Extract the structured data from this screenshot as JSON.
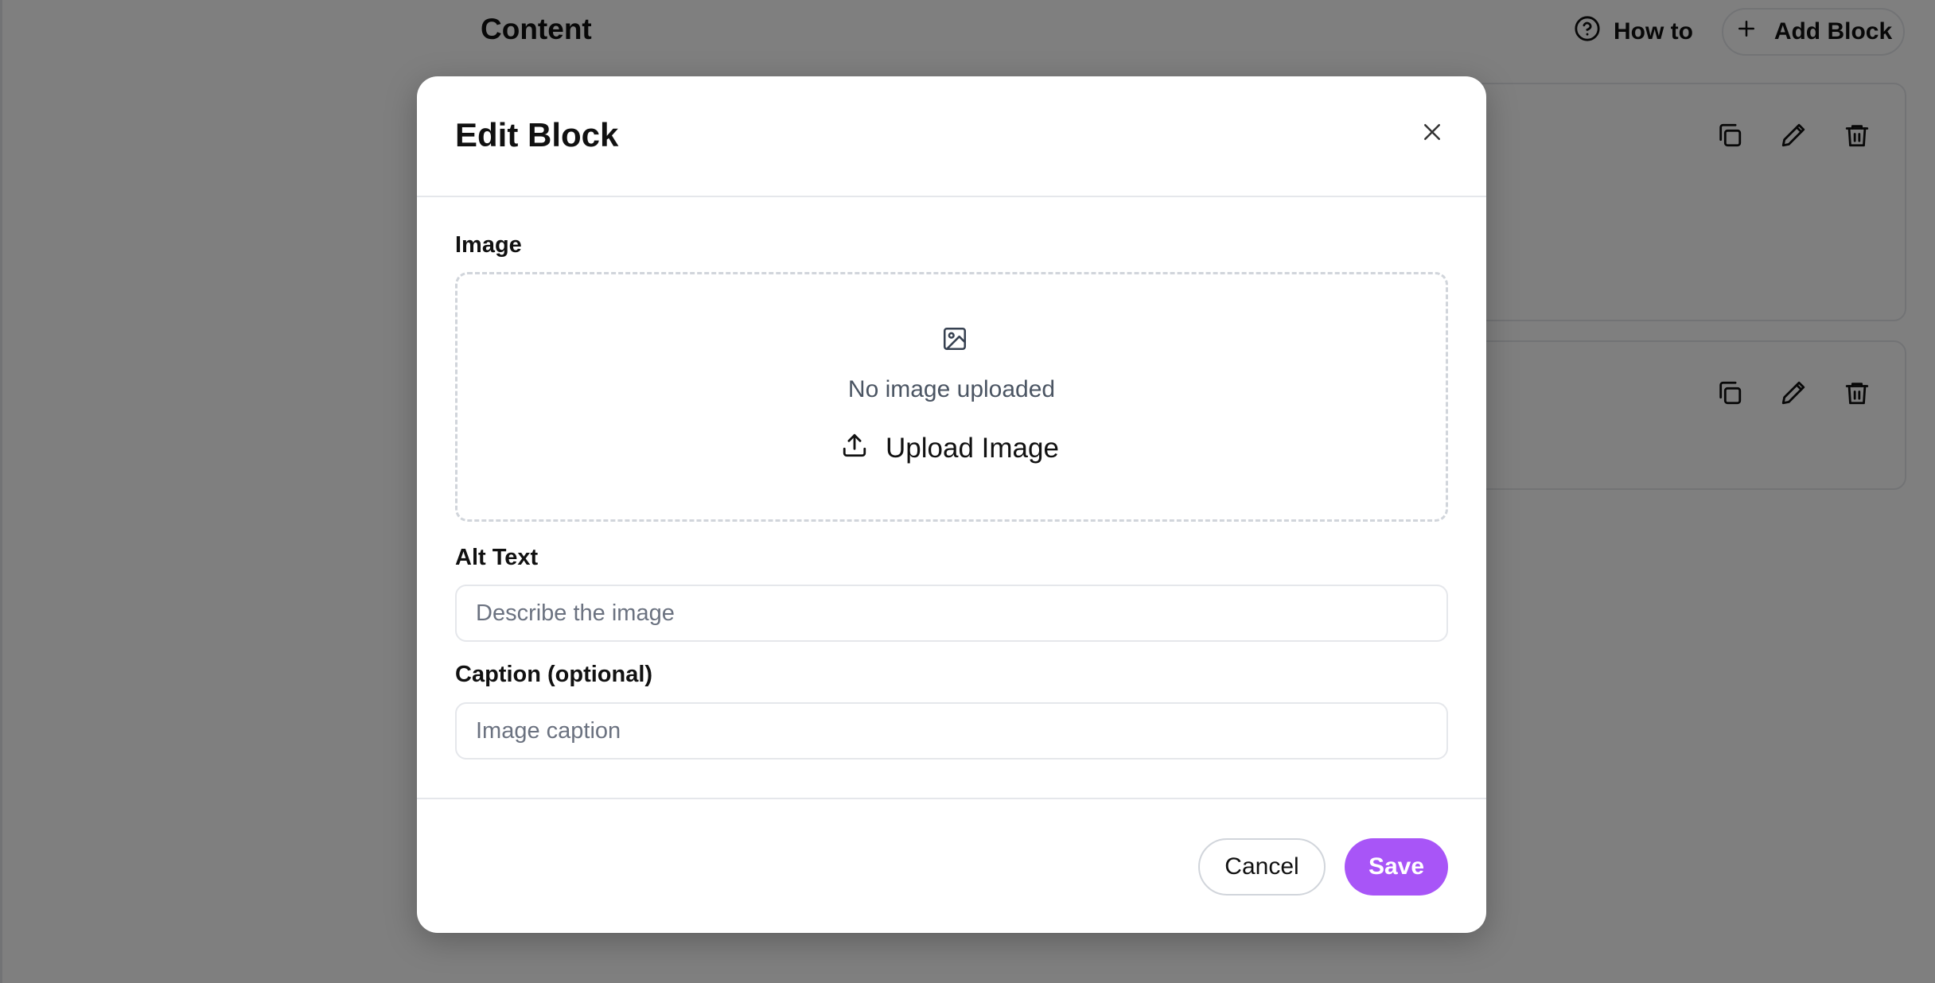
{
  "background": {
    "page_title": "Content",
    "how_to_label": "How to",
    "add_block_label": "Add Block"
  },
  "modal": {
    "title": "Edit Block",
    "image_label": "Image",
    "no_image_text": "No image uploaded",
    "upload_label": "Upload Image",
    "alt_text_label": "Alt Text",
    "alt_text_placeholder": "Describe the image",
    "alt_text_value": "",
    "caption_label": "Caption (optional)",
    "caption_placeholder": "Image caption",
    "caption_value": "",
    "cancel_label": "Cancel",
    "save_label": "Save"
  },
  "colors": {
    "accent": "#a855f7",
    "overlay": "rgba(0,0,0,0.5)",
    "border": "#e5e7eb"
  },
  "icons": {
    "how_to": "help-circle-icon",
    "add_block": "plus-icon",
    "duplicate": "copy-icon",
    "edit": "pencil-icon",
    "delete": "trash-icon",
    "close": "close-icon",
    "image_placeholder": "image-icon",
    "upload": "upload-icon"
  }
}
